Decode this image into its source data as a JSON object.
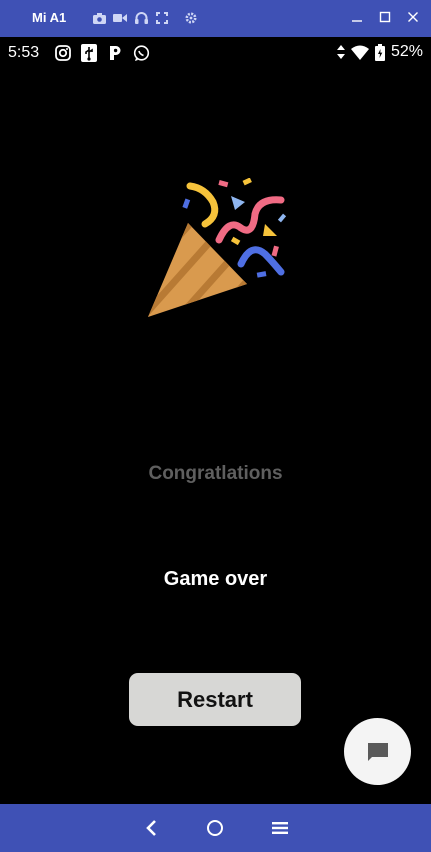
{
  "emulator": {
    "title": "Mi A1",
    "tools": [
      "camera-icon",
      "video-icon",
      "headphones-icon",
      "fullscreen-icon",
      "settings-icon"
    ],
    "window_controls": [
      "minimize-icon",
      "maximize-icon",
      "close-icon"
    ],
    "bar_color": "#3f51b5"
  },
  "status_bar": {
    "time": "5:53",
    "left_icons": [
      "instagram-icon",
      "usb-icon",
      "p-app-icon",
      "whatsapp-icon"
    ],
    "right_icons": [
      "data-arrows-icon",
      "wifi-icon",
      "battery-icon"
    ],
    "battery": "52%"
  },
  "screen": {
    "illustration": "party-popper-icon",
    "congrats_text": "Congratlations",
    "result_text": "Game over",
    "restart_label": "Restart",
    "fab_icon": "chat-icon"
  },
  "nav_bar": {
    "buttons": [
      "back-icon",
      "home-icon",
      "menu-icon"
    ]
  }
}
